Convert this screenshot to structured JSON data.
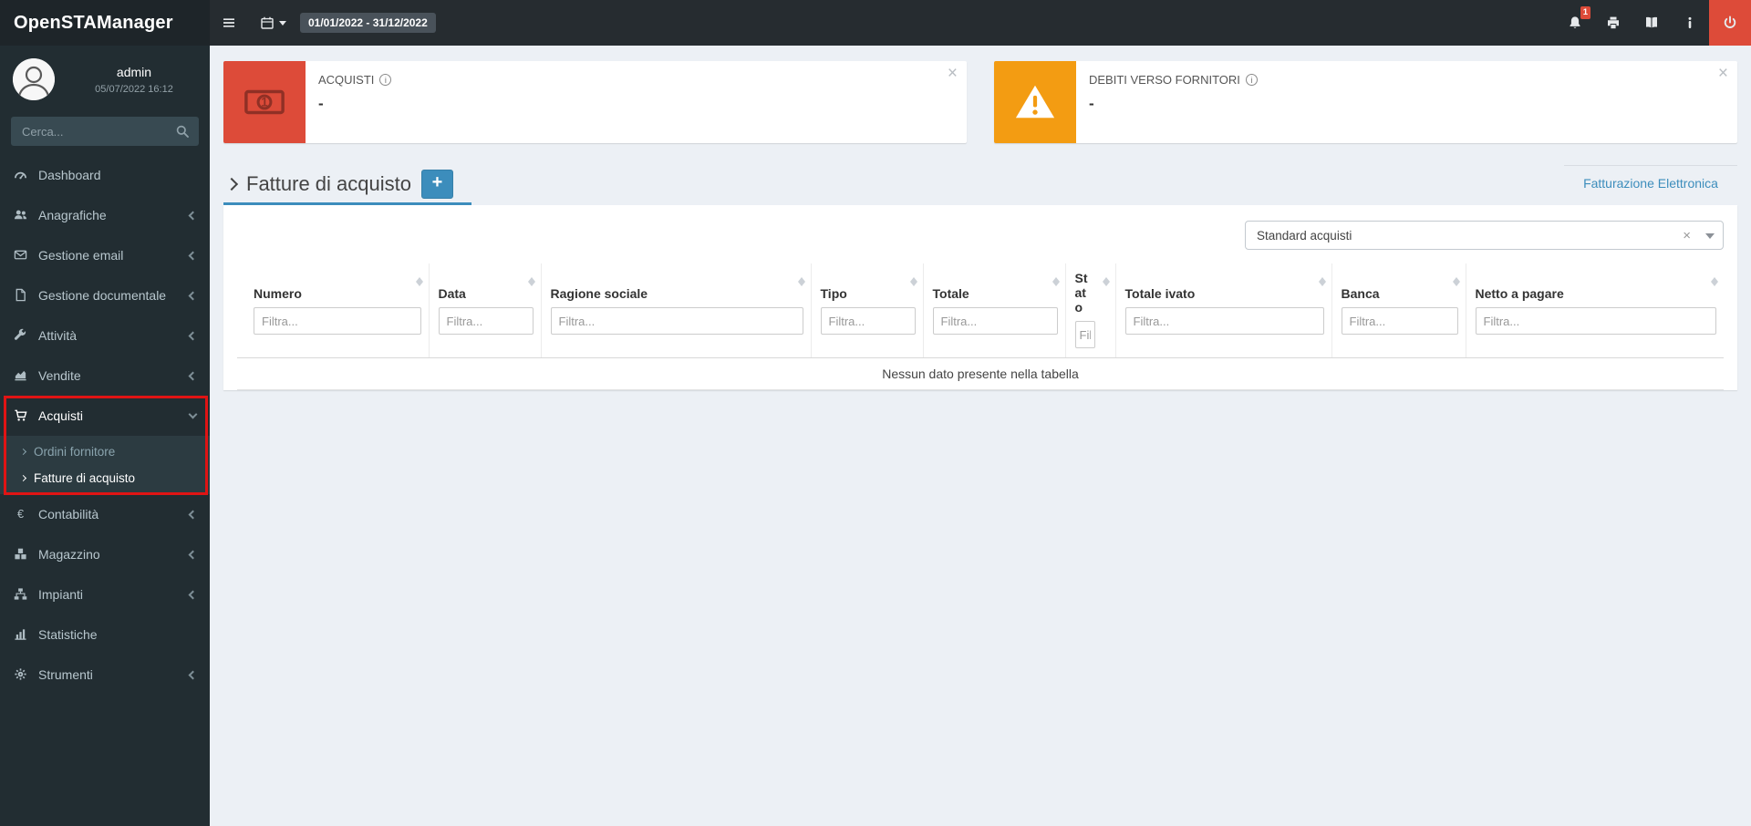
{
  "topbar": {
    "brand": "OpenSTAManager",
    "date_range": "01/01/2022 - 31/12/2022",
    "notification_badge": "1"
  },
  "sidebar": {
    "user_name": "admin",
    "user_datetime": "05/07/2022 16:12",
    "search_placeholder": "Cerca...",
    "items": [
      {
        "label": "Dashboard",
        "icon": "tachometer-icon",
        "chevron": "none"
      },
      {
        "label": "Anagrafiche",
        "icon": "users-icon",
        "chevron": "left"
      },
      {
        "label": "Gestione email",
        "icon": "envelope-icon",
        "chevron": "left"
      },
      {
        "label": "Gestione documentale",
        "icon": "document-icon",
        "chevron": "left"
      },
      {
        "label": "Attività",
        "icon": "wrench-icon",
        "chevron": "left"
      },
      {
        "label": "Vendite",
        "icon": "chart-area-icon",
        "chevron": "left"
      },
      {
        "label": "Acquisti",
        "icon": "cart-icon",
        "chevron": "down",
        "expanded": true,
        "children": [
          {
            "label": "Ordini fornitore",
            "active": false
          },
          {
            "label": "Fatture di acquisto",
            "active": true
          }
        ]
      },
      {
        "label": "Contabilità",
        "icon": "euro-icon",
        "chevron": "left"
      },
      {
        "label": "Magazzino",
        "icon": "boxes-icon",
        "chevron": "left"
      },
      {
        "label": "Impianti",
        "icon": "sitemap-icon",
        "chevron": "left"
      },
      {
        "label": "Statistiche",
        "icon": "bar-chart-icon",
        "chevron": "none"
      },
      {
        "label": "Strumenti",
        "icon": "gear-icon",
        "chevron": "left"
      }
    ]
  },
  "infoboxes": [
    {
      "label": "ACQUISTI",
      "value": "-",
      "icon": "money-icon",
      "color": "#dd4b39"
    },
    {
      "label": "DEBITI VERSO FORNITORI",
      "value": "-",
      "icon": "warning-icon",
      "color": "#f39c12"
    }
  ],
  "content": {
    "tab_title": "Fatture di acquisto",
    "add_button_label": "+",
    "right_tab_label": "Fatturazione Elettronica",
    "filter_select_value": "Standard acquisti",
    "table": {
      "columns": [
        "Numero",
        "Data",
        "Ragione sociale",
        "Tipo",
        "Totale",
        "Stato",
        "Totale ivato",
        "Banca",
        "Netto a pagare"
      ],
      "filter_placeholder": "Filtra...",
      "empty_message": "Nessun dato presente nella tabella"
    }
  },
  "colors": {
    "accent": "#3c8dbc",
    "danger": "#dd4b39",
    "warning": "#f39c12",
    "annotation": "#e01414"
  }
}
